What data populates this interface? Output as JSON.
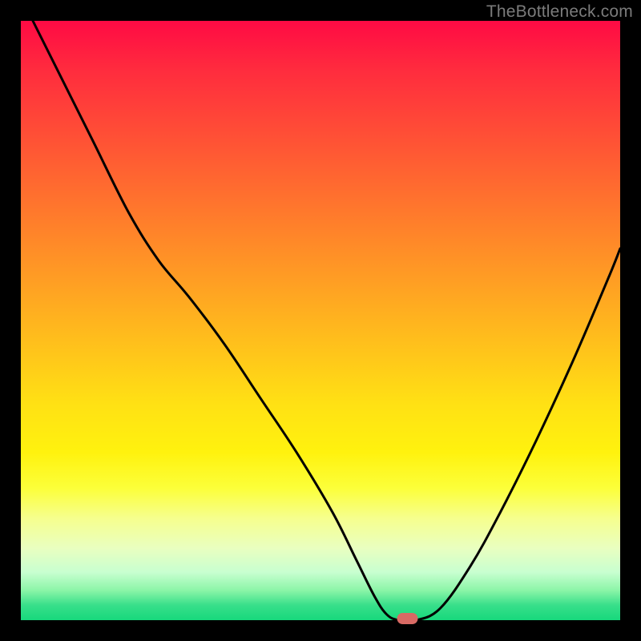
{
  "watermark": "TheBottleneck.com",
  "chart_data": {
    "type": "line",
    "title": "",
    "xlabel": "",
    "ylabel": "",
    "xlim": [
      0,
      100
    ],
    "ylim": [
      0,
      100
    ],
    "grid": false,
    "legend": false,
    "series": [
      {
        "name": "bottleneck-curve",
        "x": [
          2,
          6,
          12,
          18,
          23,
          28,
          34,
          40,
          46,
          52,
          56,
          59,
          61,
          63,
          66,
          70,
          75,
          80,
          86,
          92,
          98,
          100
        ],
        "y": [
          100,
          92,
          80,
          68,
          60,
          54,
          46,
          37,
          28,
          18,
          10,
          4,
          1,
          0,
          0,
          2,
          9,
          18,
          30,
          43,
          57,
          62
        ]
      }
    ],
    "marker": {
      "name": "optimal-point",
      "x": 64.5,
      "y": 0,
      "color": "#d86a64"
    },
    "background_gradient": {
      "top": "#ff0a44",
      "mid": "#ffe114",
      "bottom": "#17d87c"
    }
  }
}
